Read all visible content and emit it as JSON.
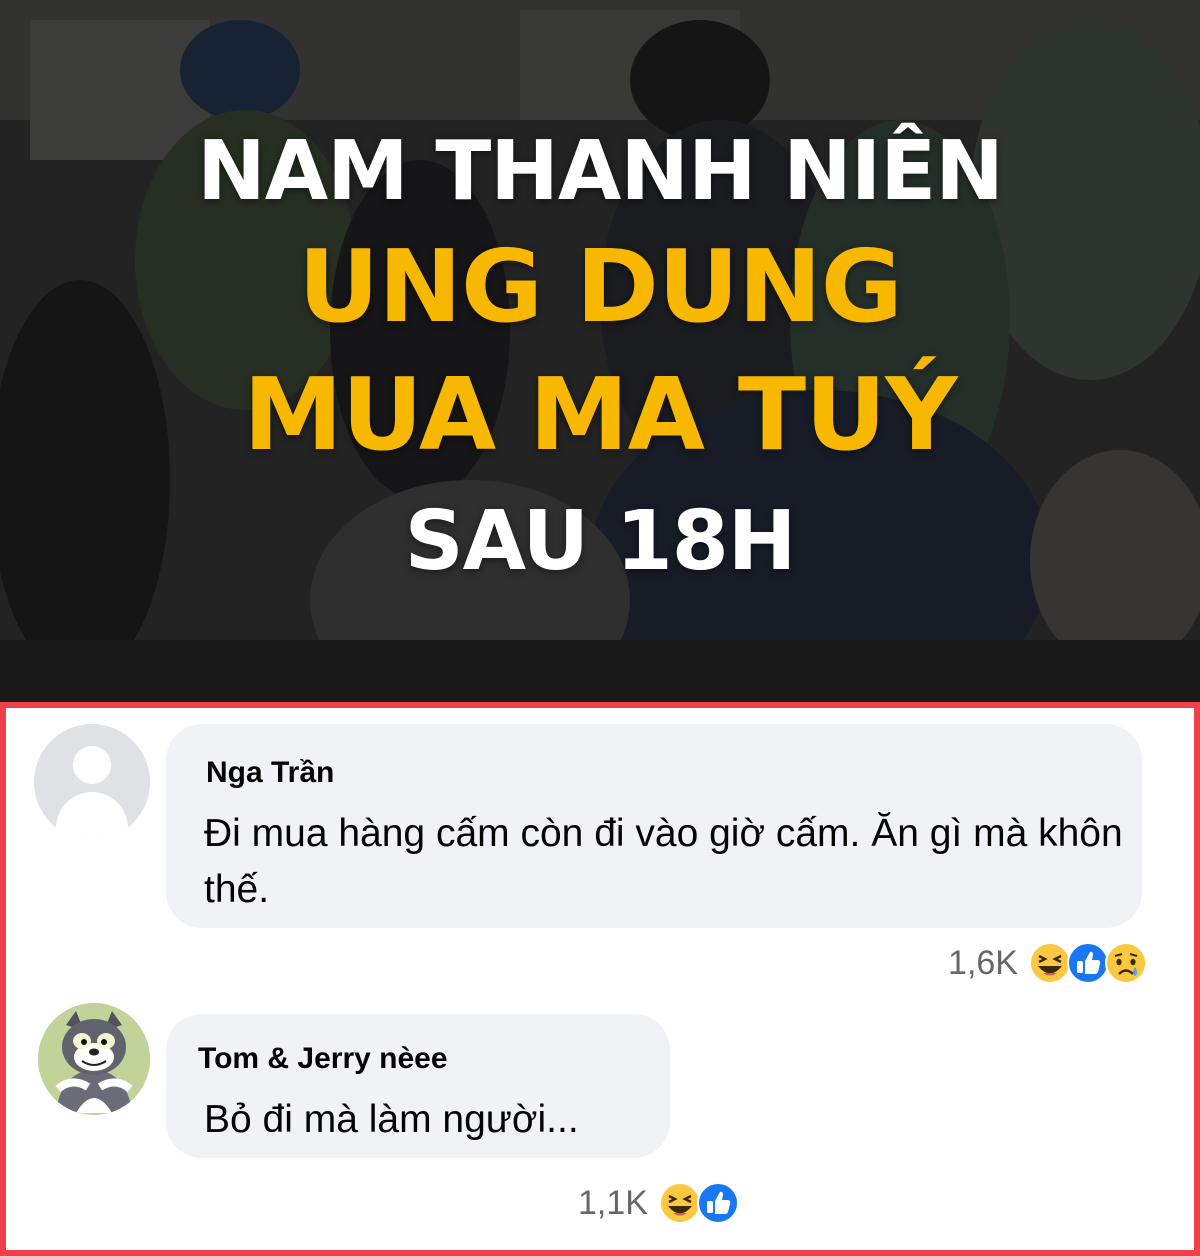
{
  "headline": {
    "line1": "NAM THANH NIÊN",
    "line2": "UNG DUNG",
    "line3": "MUA MA TUÝ",
    "line4": "SAU 18H"
  },
  "colors": {
    "headline_white": "#ffffff",
    "headline_yellow": "#f9b800",
    "panel_border": "#f0414b",
    "bubble_bg": "#f0f2f5",
    "count_gray": "#65676b"
  },
  "comments": [
    {
      "author": "Nga Trần",
      "text": "Đi mua hàng cấm còn đi vào giờ cấm. Ăn gì mà khôn thế.",
      "reaction_count": "1,6K",
      "reactions": [
        "haha-icon",
        "like-icon",
        "sad-icon"
      ],
      "avatar": "default-avatar-icon"
    },
    {
      "author": "Tom & Jerry nèee",
      "text": "Bỏ đi mà làm người...",
      "reaction_count": "1,1K",
      "reactions": [
        "haha-icon",
        "like-icon"
      ],
      "avatar": "cartoon-cat-avatar"
    }
  ]
}
